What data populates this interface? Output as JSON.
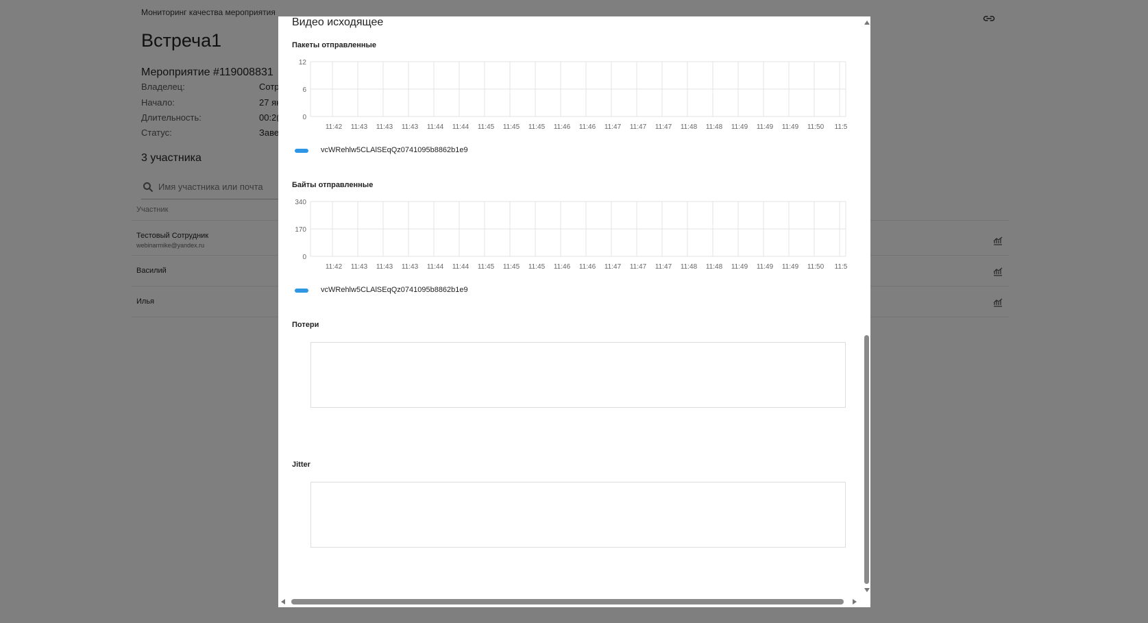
{
  "page": {
    "breadcrumb": "Мониторинг качества мероприятия",
    "title": "Встреча1",
    "event_title": "Мероприятие #119008831",
    "info": [
      {
        "label": "Владелец:",
        "value": "Сотр"
      },
      {
        "label": "Начало:",
        "value": "27 ян"
      },
      {
        "label": "Длительность:",
        "value": "00:2("
      },
      {
        "label": "Статус:",
        "value": "Заве"
      }
    ],
    "participants_title": "3 участника",
    "search_placeholder": "Имя участника или почта",
    "column_header": "Участник",
    "participants": [
      {
        "name": "Тестовый Сотрудник",
        "email": "webinarmike@yandex.ru"
      },
      {
        "name": "Василий",
        "email": ""
      },
      {
        "name": "Илья",
        "email": ""
      }
    ]
  },
  "modal": {
    "title": "Видео исходящее",
    "charts": [
      {
        "title": "Пакеты отправленные",
        "legend": "vcWRehlw5CLAlSEqQz0741095b8862b1e9",
        "legend_color": "#2f96e6"
      },
      {
        "title": "Байты отправленные",
        "legend": "vcWRehlw5CLAlSEqQz0741095b8862b1e9",
        "legend_color": "#2f96e6"
      },
      {
        "title": "Потери"
      },
      {
        "title": "Jitter"
      }
    ]
  },
  "chart_data": [
    {
      "type": "line",
      "title": "Пакеты отправленные",
      "y_ticks": [
        "12",
        "6",
        "0"
      ],
      "ylim": [
        0,
        12
      ],
      "x_ticks": [
        "11:42",
        "11:43",
        "11:43",
        "11:43",
        "11:44",
        "11:44",
        "11:45",
        "11:45",
        "11:45",
        "11:46",
        "11:46",
        "11:47",
        "11:47",
        "11:47",
        "11:48",
        "11:48",
        "11:49",
        "11:49",
        "11:49",
        "11:50",
        "11:5"
      ],
      "grid": true,
      "series": [
        {
          "name": "vcWRehlw5CLAlSEqQz0741095b8862b1e9",
          "values": []
        }
      ]
    },
    {
      "type": "line",
      "title": "Байты отправленные",
      "y_ticks": [
        "340",
        "170",
        "0"
      ],
      "ylim": [
        0,
        340
      ],
      "x_ticks": [
        "11:42",
        "11:43",
        "11:43",
        "11:43",
        "11:44",
        "11:44",
        "11:45",
        "11:45",
        "11:45",
        "11:46",
        "11:46",
        "11:47",
        "11:47",
        "11:47",
        "11:48",
        "11:48",
        "11:49",
        "11:49",
        "11:49",
        "11:50",
        "11:5"
      ],
      "grid": true,
      "series": [
        {
          "name": "vcWRehlw5CLAlSEqQz0741095b8862b1e9",
          "values": []
        }
      ]
    },
    {
      "type": "line",
      "title": "Потери",
      "series": []
    },
    {
      "type": "line",
      "title": "Jitter",
      "series": []
    }
  ]
}
